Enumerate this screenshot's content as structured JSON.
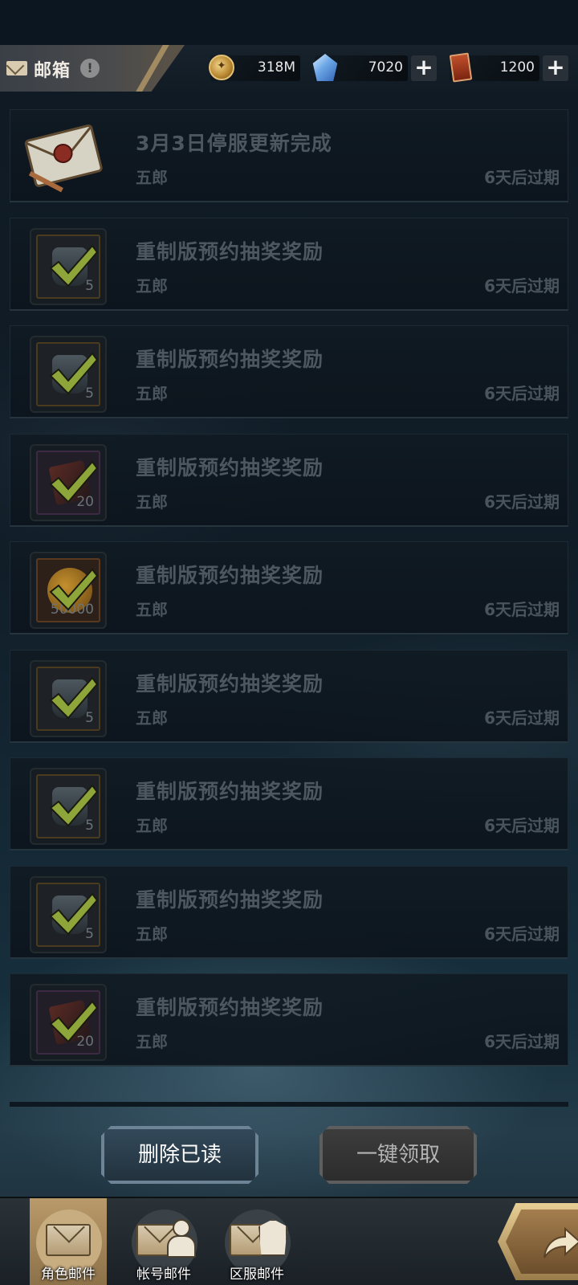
{
  "header": {
    "title": "邮箱",
    "info_icon": "!",
    "resources": [
      {
        "icon": "gold-coin-icon",
        "value": "318M",
        "has_plus": false
      },
      {
        "icon": "crystal-gem-icon",
        "value": "7020",
        "has_plus": true
      },
      {
        "icon": "ticket-icon",
        "value": "1200",
        "has_plus": true
      }
    ]
  },
  "mails": [
    {
      "title": "3月3日停服更新完成",
      "sender": "五郎",
      "expire": "6天后过期",
      "thumb": "envelope",
      "qty": ""
    },
    {
      "title": "重制版预约抽奖奖励",
      "sender": "五郎",
      "expire": "6天后过期",
      "thumb": "jar",
      "qty": "5"
    },
    {
      "title": "重制版预约抽奖奖励",
      "sender": "五郎",
      "expire": "6天后过期",
      "thumb": "jar",
      "qty": "5"
    },
    {
      "title": "重制版预约抽奖奖励",
      "sender": "五郎",
      "expire": "6天后过期",
      "thumb": "flag",
      "qty": "20"
    },
    {
      "title": "重制版预约抽奖奖励",
      "sender": "五郎",
      "expire": "6天后过期",
      "thumb": "coin",
      "qty": "50000"
    },
    {
      "title": "重制版预约抽奖奖励",
      "sender": "五郎",
      "expire": "6天后过期",
      "thumb": "jar",
      "qty": "5"
    },
    {
      "title": "重制版预约抽奖奖励",
      "sender": "五郎",
      "expire": "6天后过期",
      "thumb": "jar",
      "qty": "5"
    },
    {
      "title": "重制版预约抽奖奖励",
      "sender": "五郎",
      "expire": "6天后过期",
      "thumb": "jar",
      "qty": "5"
    },
    {
      "title": "重制版预约抽奖奖励",
      "sender": "五郎",
      "expire": "6天后过期",
      "thumb": "flag",
      "qty": "20"
    }
  ],
  "actions": {
    "delete_read": "删除已读",
    "claim_all": "一键领取"
  },
  "nav": {
    "tabs": [
      {
        "label": "角色邮件",
        "active": true
      },
      {
        "label": "帐号邮件",
        "active": false
      },
      {
        "label": "区服邮件",
        "active": false
      }
    ]
  },
  "colors": {
    "claimed_check": "#8ea53a",
    "active_tab": "#b99a6a"
  }
}
